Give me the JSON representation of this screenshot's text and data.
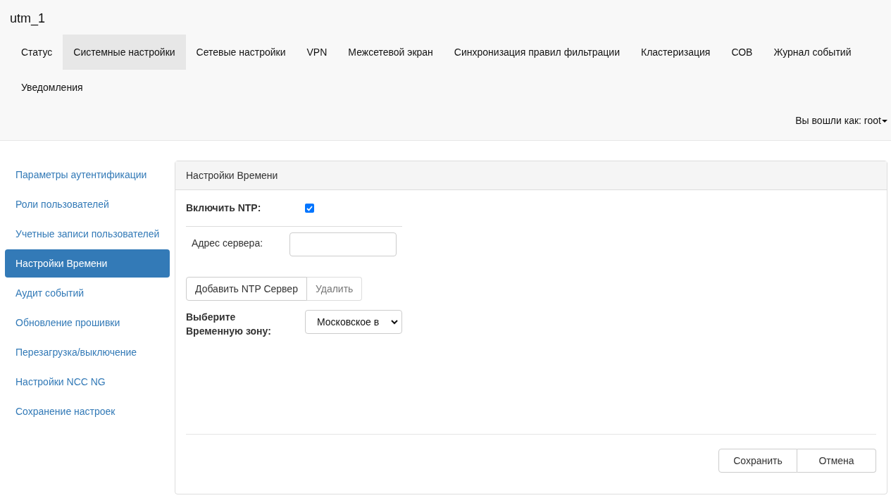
{
  "brand": "utm_1",
  "nav": [
    {
      "label": "Статус",
      "selected": false
    },
    {
      "label": "Системные настройки",
      "selected": true
    },
    {
      "label": "Сетевые настройки",
      "selected": false
    },
    {
      "label": "VPN",
      "selected": false
    },
    {
      "label": "Межсетевой экран",
      "selected": false
    },
    {
      "label": "Синхронизация правил фильтрации",
      "selected": false
    },
    {
      "label": "Кластеризация",
      "selected": false
    },
    {
      "label": "СОВ",
      "selected": false
    },
    {
      "label": "Журнал событий",
      "selected": false
    },
    {
      "label": "Уведомления",
      "selected": false
    }
  ],
  "user_menu": "Вы вошли как: root",
  "sidebar": {
    "items": [
      {
        "label": "Параметры аутентификации",
        "selected": false
      },
      {
        "label": "Роли пользователей",
        "selected": false
      },
      {
        "label": "Учетные записи пользователей",
        "selected": false
      },
      {
        "label": "Настройки Времени",
        "selected": true
      },
      {
        "label": "Аудит событий",
        "selected": false
      },
      {
        "label": "Обновление прошивки",
        "selected": false
      },
      {
        "label": "Перезагрузка/выключение",
        "selected": false
      },
      {
        "label": "Настройки NCC NG",
        "selected": false
      },
      {
        "label": "Сохранение настроек",
        "selected": false
      }
    ]
  },
  "panel": {
    "title": "Настройки Времени",
    "ntp": {
      "label": "Включить NTP:",
      "checked": true
    },
    "server": {
      "label": "Адрес сервера:"
    },
    "add_button": "Добавить NTP Сервер",
    "delete_button": {
      "label": "Удалить",
      "disabled": true
    },
    "timezone": {
      "label_lines": [
        "Выберите",
        "Временную зону:"
      ],
      "value": "Московское в"
    },
    "buttons": [
      "Сохранить",
      "Отмена"
    ]
  }
}
